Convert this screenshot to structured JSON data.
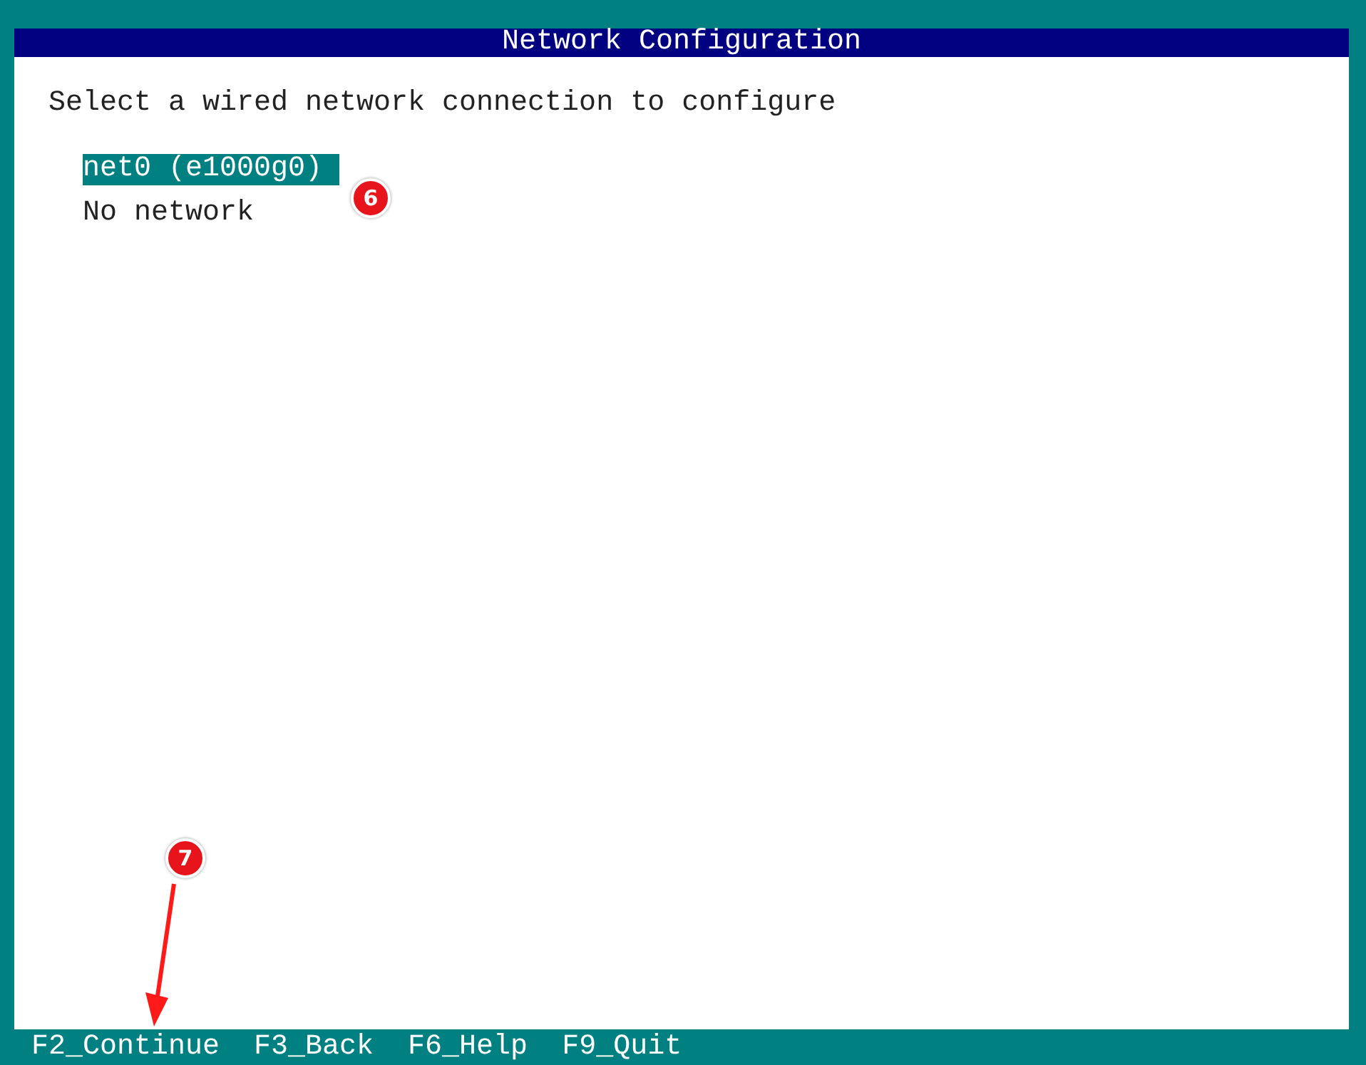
{
  "window": {
    "title": "Network Configuration"
  },
  "prompt": "Select a wired network connection to configure",
  "connections": [
    {
      "label": "net0 (e1000g0)",
      "selected": true
    },
    {
      "label": "No network",
      "selected": false
    }
  ],
  "function_keys": [
    "F2_Continue",
    "F3_Back",
    "F6_Help",
    "F9_Quit"
  ],
  "callouts": [
    {
      "number": "6",
      "kind": "badge"
    },
    {
      "number": "7",
      "kind": "arrow"
    }
  ]
}
